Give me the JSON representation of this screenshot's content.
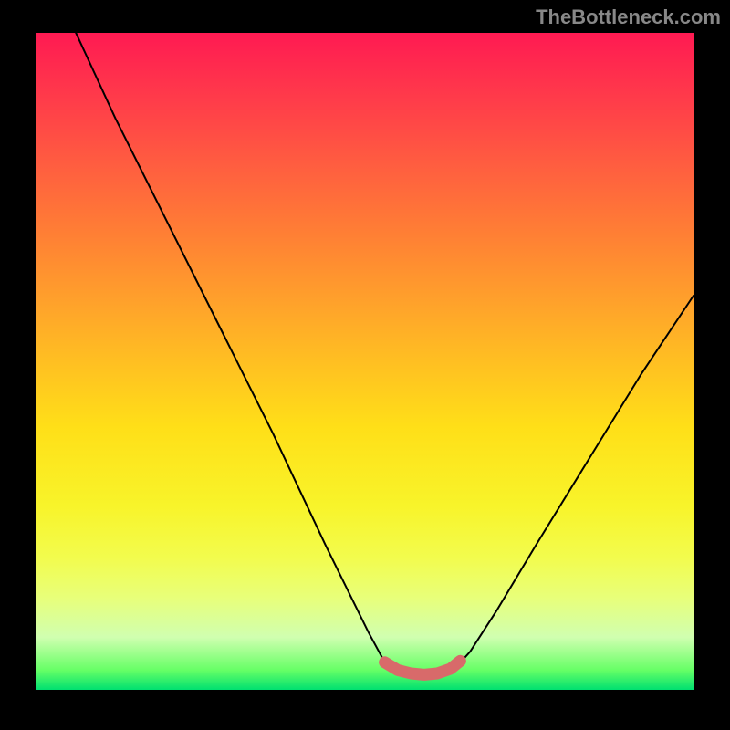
{
  "watermark": "TheBottleneck.com",
  "chart_data": {
    "type": "line",
    "title": "",
    "xlabel": "",
    "ylabel": "",
    "xlim": [
      0,
      100
    ],
    "ylim": [
      0,
      100
    ],
    "series": [
      {
        "name": "curve",
        "x": [
          6,
          12,
          20,
          28,
          36,
          44,
          50.5,
          53,
          56,
          59,
          62,
          64,
          66,
          70,
          76,
          84,
          92,
          100
        ],
        "values": [
          100,
          87,
          71,
          55,
          39,
          22,
          8.8,
          4.2,
          2.6,
          2.3,
          2.6,
          3.6,
          5.8,
          12,
          22,
          35,
          48,
          60
        ]
      },
      {
        "name": "bottom-marker",
        "x": [
          53,
          55,
          57,
          59,
          61,
          63,
          64.5
        ],
        "values": [
          4.2,
          3.0,
          2.5,
          2.3,
          2.5,
          3.2,
          4.4
        ]
      }
    ],
    "colors": {
      "curve": "#000000",
      "marker": "#d86a6a"
    }
  }
}
